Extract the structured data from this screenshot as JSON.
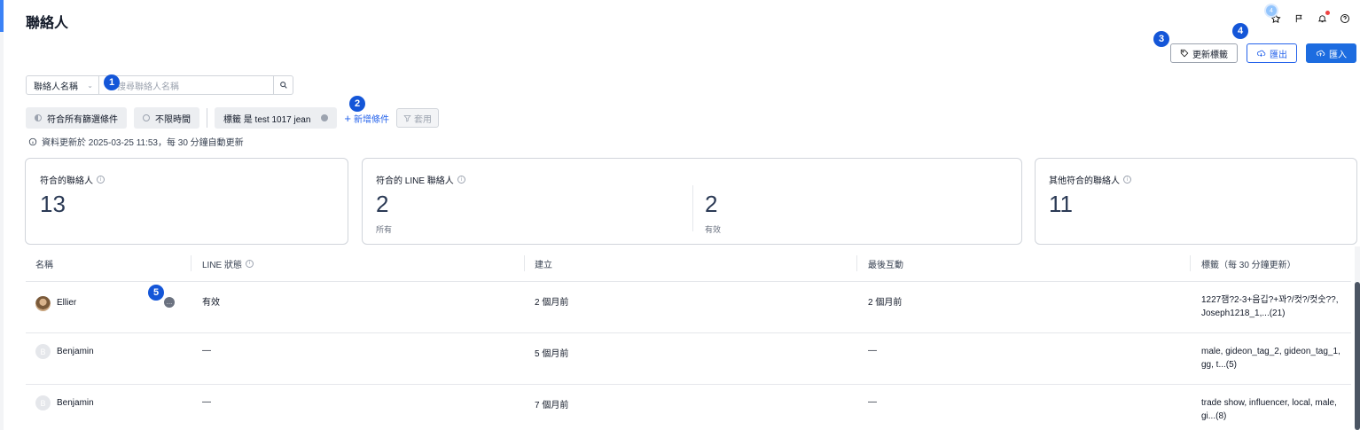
{
  "header": {
    "title": "聯絡人",
    "star_badge": "4"
  },
  "actions": {
    "update_tags": "更新標籤",
    "export": "匯出",
    "import": "匯入"
  },
  "steps": [
    "1",
    "2",
    "3",
    "4",
    "5"
  ],
  "search": {
    "field_select": "聯絡人名稱",
    "placeholder": "搜尋聯絡人名稱"
  },
  "filters": {
    "match_all": "符合所有篩選條件",
    "time": "不限時間",
    "tag_filter": "標籤 是 test 1017 jean",
    "add_condition": "新增條件",
    "apply": "套用"
  },
  "update_info": "資料更新於 2025-03-25 11:53，每 30 分鐘自動更新",
  "stats": {
    "matched_contacts": {
      "label": "符合的聯絡人",
      "value": "13"
    },
    "line_contacts": {
      "label": "符合的 LINE 聯絡人",
      "all_value": "2",
      "all_label": "所有",
      "valid_value": "2",
      "valid_label": "有效"
    },
    "other_contacts": {
      "label": "其他符合的聯絡人",
      "value": "11"
    }
  },
  "table": {
    "headers": {
      "name": "名稱",
      "line_status": "LINE 狀態",
      "created": "建立",
      "last_interaction": "最後互動",
      "tags": "標籤（每 30 分鐘更新）"
    },
    "rows": [
      {
        "initial": "",
        "name": "Ellier",
        "line_status": "有效",
        "created": "2 個月前",
        "last_interaction": "2 個月前",
        "tags": "1227잼?2-3+음깁?+꽈?/컷?/컷숫??, Joseph1218_1,...(21)"
      },
      {
        "initial": "B",
        "name": "Benjamin",
        "line_status": "—",
        "created": "5 個月前",
        "last_interaction": "—",
        "tags": "male, gideon_tag_2, gideon_tag_1, gg, t...(5)"
      },
      {
        "initial": "B",
        "name": "Benjamin",
        "line_status": "—",
        "created": "7 個月前",
        "last_interaction": "—",
        "tags": "trade show, influencer, local, male, gi...(8)"
      }
    ]
  }
}
